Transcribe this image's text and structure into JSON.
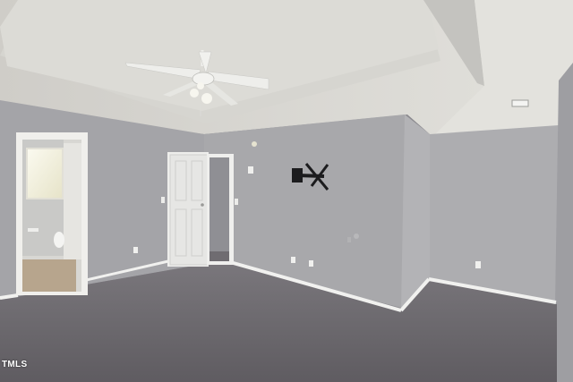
{
  "scene": {
    "description_free": true,
    "watermark": "TMLS",
    "colors": {
      "wall": "#a9a9ab",
      "wall_shadow": "#9c9ca0",
      "wall_light": "#b9b9bb",
      "ceiling": "#d9d8d3",
      "ceiling_tray": "#cfcecb",
      "carpet": "#6d6a6e",
      "baseboard": "#f1f1ef",
      "door": "#e8e8e6",
      "bathroom_floor": "#b7a58d",
      "window_light": "#f4f2d8"
    },
    "icons": [
      "ceiling-fan-icon",
      "tv-wall-mount-icon",
      "outlet-icon",
      "door-icon",
      "window-icon",
      "toilet-icon"
    ]
  }
}
